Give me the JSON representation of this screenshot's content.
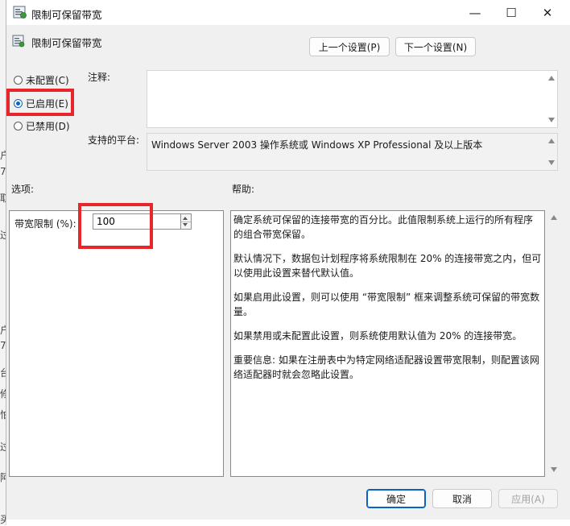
{
  "background_window": {
    "edge_glyphs": [
      "户",
      "7",
      "取",
      "过",
      "户",
      "7",
      "台",
      "修",
      "怕",
      "过",
      "阿",
      "买司"
    ]
  },
  "window": {
    "title": "限制可保留带宽",
    "controls": {
      "minimize": "—",
      "maximize": "☐",
      "close": "✕"
    }
  },
  "header": {
    "setting_name": "限制可保留带宽",
    "prev_button": "上一个设置(P)",
    "next_button": "下一个设置(N)"
  },
  "state": {
    "options": [
      {
        "label": "未配置(C)",
        "checked": false
      },
      {
        "label": "已启用(E)",
        "checked": true
      },
      {
        "label": "已禁用(D)",
        "checked": false
      }
    ]
  },
  "comment": {
    "label": "注释:",
    "value": ""
  },
  "platform": {
    "label": "支持的平台:",
    "value": "Windows Server 2003 操作系统或 Windows XP Professional 及以上版本"
  },
  "options_section": {
    "label": "选项:",
    "bandwidth_label": "带宽限制 (%):",
    "bandwidth_value": "100"
  },
  "help_section": {
    "label": "帮助:",
    "paragraphs": [
      "确定系统可保留的连接带宽的百分比。此值限制系统上运行的所有程序的组合带宽保留。",
      "默认情况下，数据包计划程序将系统限制在 20% 的连接带宽之内，但可以使用此设置来替代默认值。",
      "如果启用此设置，则可以使用 “带宽限制” 框来调整系统可保留的带宽数量。",
      "如果禁用或未配置此设置，则系统使用默认值为 20% 的连接带宽。",
      "重要信息: 如果在注册表中为特定网络适配器设置带宽限制，则配置该网络适配器时就会忽略此设置。"
    ]
  },
  "footer": {
    "ok": "确定",
    "cancel": "取消",
    "apply": "应用(A)"
  },
  "colors": {
    "highlight": "#e8252a",
    "accent": "#0a63c4",
    "dialog_bg": "#f0f0f0"
  }
}
